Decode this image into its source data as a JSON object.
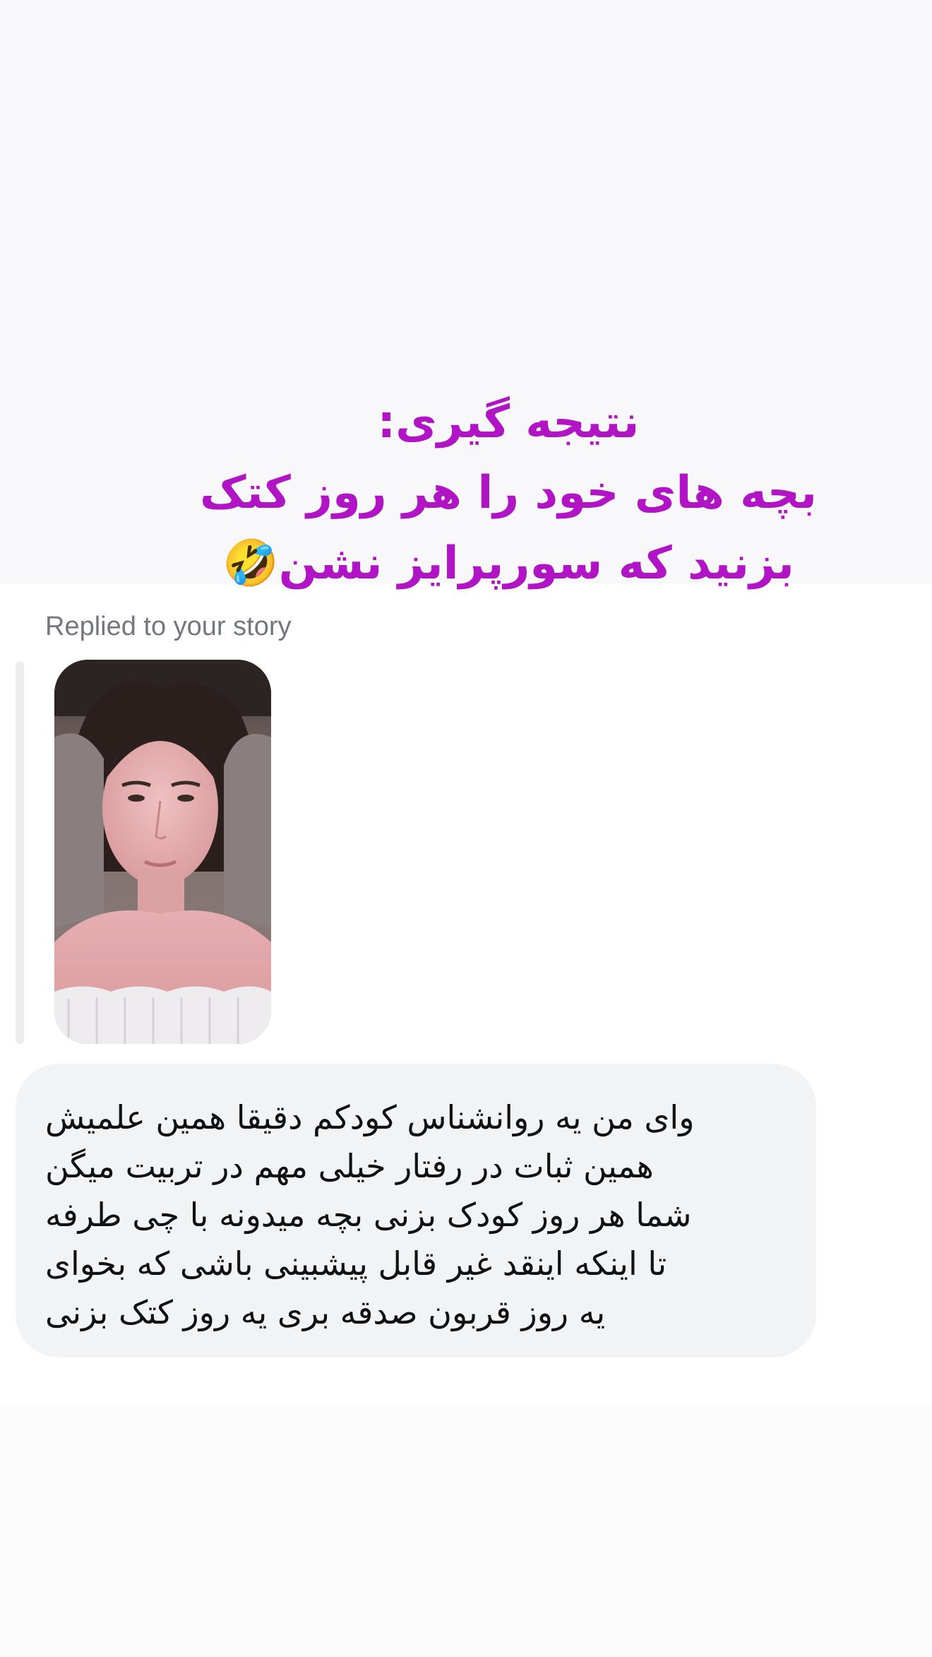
{
  "story_caption": {
    "lines": [
      "نتیجه گیری:",
      "بچه های خود را هر روز کتک",
      "بزنید که سورپرایز نشن🤣"
    ],
    "color": "#b014c4"
  },
  "reply": {
    "label": "Replied to your story"
  },
  "story_thumbnail": {
    "icon": "story-photo-thumbnail"
  },
  "message": {
    "lines": [
      "وای من یه روانشناس کودکم دقیقا همین علمیش",
      "همین ثبات در رفتار خیلی مهم در تربیت میگن",
      "شما هر روز کودک بزنی بچه میدونه با چی طرفه",
      "تا اینکه اینقد غیر قابل پیشبینی باشی که بخوای",
      "یه روز قربون صدقه بری یه روز کتک بزنی"
    ],
    "bubble_color": "#f2f3f5"
  }
}
